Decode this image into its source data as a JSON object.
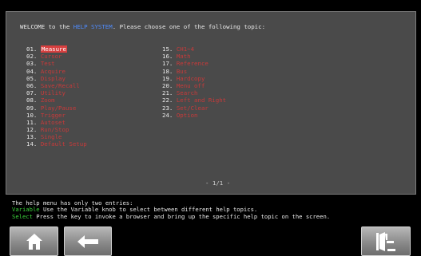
{
  "help": {
    "intro_prefix": "WELCOME to the ",
    "intro_keyword": "HELP SYSTEM",
    "intro_suffix": ". Please choose one of the following topic:",
    "topics_col1": [
      {
        "num": "01.",
        "label": "Measure",
        "selected": true
      },
      {
        "num": "02.",
        "label": "Cursor"
      },
      {
        "num": "03.",
        "label": "Test"
      },
      {
        "num": "04.",
        "label": "Acquire"
      },
      {
        "num": "05.",
        "label": "Display"
      },
      {
        "num": "06.",
        "label": "Save/Recall"
      },
      {
        "num": "07.",
        "label": "Utility"
      },
      {
        "num": "08.",
        "label": "Zoom"
      },
      {
        "num": "09.",
        "label": "Play/Pause"
      },
      {
        "num": "10.",
        "label": "Trigger"
      },
      {
        "num": "11.",
        "label": "Autoset"
      },
      {
        "num": "12.",
        "label": "Run/Stop"
      },
      {
        "num": "13.",
        "label": "Single"
      },
      {
        "num": "14.",
        "label": "Default Setup"
      }
    ],
    "topics_col2": [
      {
        "num": "15.",
        "label": "CH1~4"
      },
      {
        "num": "16.",
        "label": "Math"
      },
      {
        "num": "17.",
        "label": "Reference"
      },
      {
        "num": "18.",
        "label": "Bus"
      },
      {
        "num": "19.",
        "label": "Hardcopy"
      },
      {
        "num": "20.",
        "label": "Menu off"
      },
      {
        "num": "21.",
        "label": "Search"
      },
      {
        "num": "22.",
        "label": "Left and Right"
      },
      {
        "num": "23.",
        "label": "Set/Clear"
      },
      {
        "num": "24.",
        "label": "Option"
      }
    ],
    "page_indicator": "- 1/1 -"
  },
  "info": {
    "line1": "The help menu has only two entries:",
    "line2_key": "Variable",
    "line2_text": " Use the Variable knob to select between different help topics.",
    "line3_key": "Select",
    "line3_text": " Press the key to invoke a browser and bring up the specific help topic on the screen."
  },
  "buttons": {
    "home_icon": "home-icon",
    "back_icon": "back-arrow-icon",
    "exit_icon": "exit-door-icon"
  },
  "colors": {
    "panel_bg": "#4a4a4a",
    "topic_label": "#c83a3a",
    "selected_bg": "#d84040",
    "keyword_blue": "#4f8cff",
    "info_green": "#3bd33b"
  }
}
